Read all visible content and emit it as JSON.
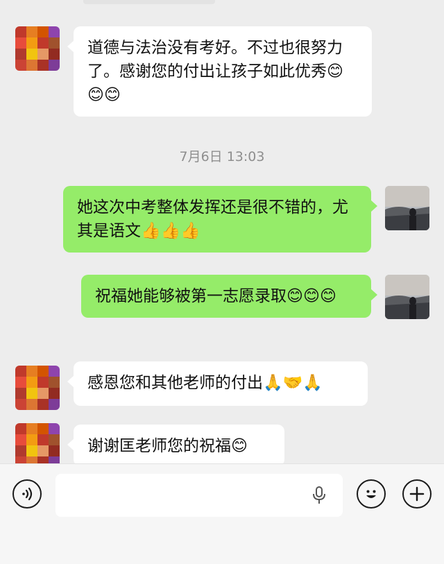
{
  "messages": [
    {
      "side": "left",
      "text": "道德与法治没有考好。不过也很努力了。感谢您的付出让孩子如此优秀😊😊😊"
    },
    {
      "side": "right",
      "text": "她这次中考整体发挥还是很不错的，尤其是语文👍👍👍"
    },
    {
      "side": "right",
      "text": "祝福她能够被第一志愿录取😊😊😊"
    },
    {
      "side": "left",
      "text": "感恩您和其他老师的付出🙏🤝🙏"
    },
    {
      "side": "left",
      "text": "谢谢匡老师您的祝福😊"
    }
  ],
  "timestamp": "7月6日 13:03",
  "input": {
    "placeholder": "",
    "voice_icon": "voice-icon",
    "mic_icon": "microphone-icon",
    "emoji_icon": "emoji-icon",
    "plus_icon": "plus-icon"
  },
  "colors": {
    "background": "#ededed",
    "sent_bubble": "#95ec69",
    "received_bubble": "#ffffff",
    "timestamp": "#8e8e8e"
  }
}
